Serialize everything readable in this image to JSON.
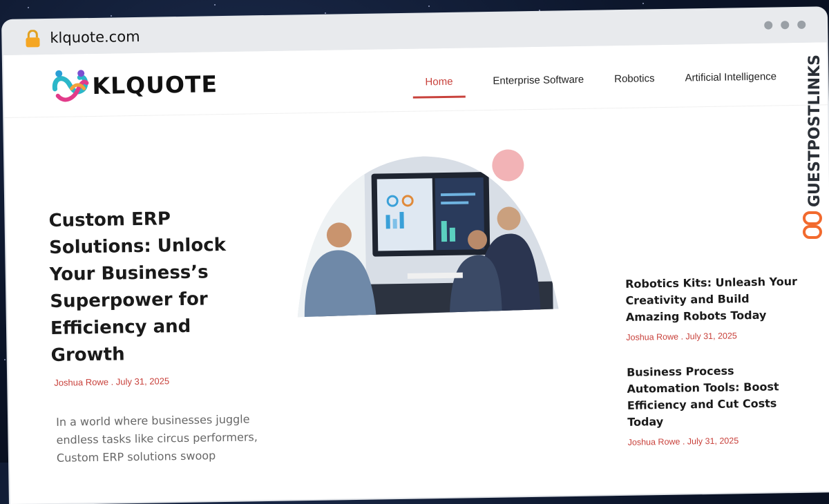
{
  "browser": {
    "url": "klquote.com",
    "icons": [
      "lock-icon",
      "window-dots-icon"
    ]
  },
  "site": {
    "logo_text": "KLQUOTE",
    "nav": [
      {
        "label": "Home",
        "active": true
      },
      {
        "label": "Enterprise Software",
        "active": false
      },
      {
        "label": "Robotics",
        "active": false
      },
      {
        "label": "Artificial Intelligence",
        "active": false
      }
    ]
  },
  "hero": {
    "title": "Custom ERP Solutions: Unlock Your Business’s Superpower for Efficiency and Growth",
    "meta": "Joshua Rowe . July 31, 2025",
    "excerpt": "In a world where businesses juggle endless tasks like circus performers, Custom ERP solutions swoop"
  },
  "sidebar": [
    {
      "title": "Robotics Kits: Unleash Your Creativity and Build Amazing Robots Today",
      "meta": "Joshua Rowe . July 31, 2025"
    },
    {
      "title": "Business Process Automation Tools: Boost Efficiency and Cut Costs Today",
      "meta": "Joshua Rowe . July 31, 2025"
    }
  ],
  "watermark": {
    "text": "GUESTPOSTLINKS"
  },
  "colors": {
    "accent": "#c8413b",
    "pink": "#f2b3b6",
    "orange": "#f26a2e"
  }
}
